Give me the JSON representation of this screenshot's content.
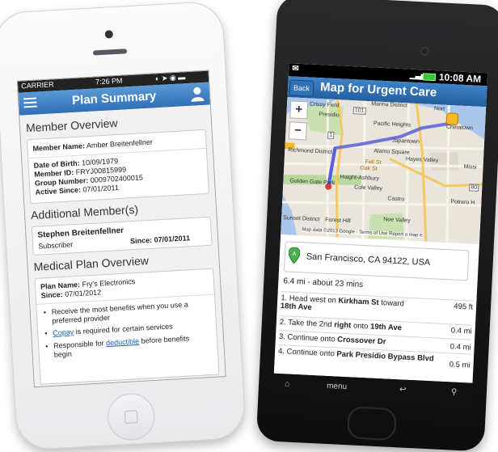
{
  "iphone": {
    "status": {
      "carrier": "CARRIER",
      "time": "7:26 PM"
    },
    "nav": {
      "title": "Plan Summary",
      "menu_icon": "hamburger-menu-icon",
      "person_icon": "person-icon"
    },
    "member_overview": {
      "heading": "Member Overview",
      "name_label": "Member Name:",
      "name_value": "Amber Breitenfellner",
      "dob_label": "Date of Birth:",
      "dob_value": "10/09/1979",
      "id_label": "Member ID:",
      "id_value": "FRYJ00815999",
      "group_label": "Group Number:",
      "group_value": "0009702400015",
      "active_label": "Active Since:",
      "active_value": "07/01/2011"
    },
    "additional": {
      "heading": "Additional Member(s)",
      "name": "Stephen Breitenfellner",
      "role": "Subscriber",
      "since_label": "Since:",
      "since_value": "07/01/2011"
    },
    "medical_plan": {
      "heading": "Medical Plan Overview",
      "plan_label": "Plan Name:",
      "plan_value": "Fry's Electronics",
      "since_label": "Since:",
      "since_value": "07/01/2012",
      "bullet1": "Receive the most benefits when you use a preferred provider",
      "bullet2_link": "Copay",
      "bullet2_rest": " is required for certain services",
      "bullet3_pre": "Responsible for ",
      "bullet3_link": "deductible",
      "bullet3_post": " before benefits begin"
    }
  },
  "android": {
    "status": {
      "time": "10:08 AM"
    },
    "action_bar": {
      "back": "Back",
      "title": "Map for Urgent Care"
    },
    "map": {
      "labels": {
        "crissy_field": "Crissy Field",
        "marina": "Marina District",
        "presidio": "Presidio",
        "pacific_heights": "Pacific Heights",
        "japantown": "Japantown",
        "chinatown": "Chinatown",
        "north": "Nort",
        "richmond": "Richmond District",
        "alamo": "Alamo Square",
        "hayes": "Hayes Valley",
        "haight": "Haight-Ashbury",
        "cole": "Cole Valley",
        "golden_gate": "Golden Gate Park",
        "castro": "Castro",
        "potrero": "Potrero H",
        "noe": "Noe Valley",
        "sunset": "Sunset District",
        "forest_hill": "Forest Hill",
        "mission": "Missi",
        "fell": "Fell St",
        "oak": "Oak St",
        "r101": "101",
        "r1": "1",
        "r80": "80"
      },
      "attribution": "Map data ©2013 Google - Terms of Use  Report a map e",
      "zoom_in": "+",
      "zoom_out": "−"
    },
    "directions": {
      "address": "San Francisco, CA 94122, USA",
      "summary": "6.4 mi - about 23 mins",
      "steps": [
        {
          "n": "1.",
          "pre": "Head west on ",
          "b1": "Kirkham St",
          "mid": " toward ",
          "b2": "18th Ave",
          "d": "495 ft"
        },
        {
          "n": "2.",
          "pre": "Take the 2nd ",
          "b1": "right",
          "mid": " onto ",
          "b2": "19th Ave",
          "d": "0.4 mi"
        },
        {
          "n": "3.",
          "pre": "Continue onto ",
          "b1": "Crossover Dr",
          "mid": "",
          "b2": "",
          "d": "0.4 mi"
        },
        {
          "n": "4.",
          "pre": "Continue onto ",
          "b1": "Park Presidio Bypass Blvd",
          "mid": "",
          "b2": "",
          "d": "0.5 mi"
        }
      ]
    },
    "softkeys": {
      "menu": "menu"
    }
  }
}
